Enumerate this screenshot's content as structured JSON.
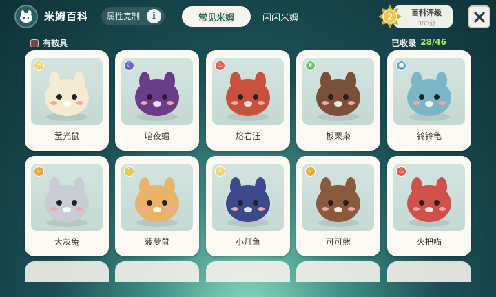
{
  "app": {
    "title": "米姆百科"
  },
  "attribute": {
    "label": "属性克制",
    "info_glyph": "i"
  },
  "tabs": [
    {
      "label": "常见米姆",
      "active": true
    },
    {
      "label": "闪闪米姆",
      "active": false
    }
  ],
  "rank": {
    "level": "2",
    "title": "百科评级",
    "score": "380分"
  },
  "filter": {
    "label": "有鞍具",
    "checked": true
  },
  "collection": {
    "label": "已收录",
    "count": "28/46"
  },
  "creatures": [
    {
      "name": "萤光鼠",
      "element": "light",
      "element_color": "#f2d46b"
    },
    {
      "name": "暗夜蝠",
      "element": "dark",
      "element_color": "#6b63c9"
    },
    {
      "name": "熔岩汪",
      "element": "fire",
      "element_color": "#ea5a4c"
    },
    {
      "name": "板栗枭",
      "element": "grass",
      "element_color": "#6cc16c"
    },
    {
      "name": "铃铃龟",
      "element": "water",
      "element_color": "#55a7e0"
    },
    {
      "name": "大灰兔",
      "element": "normal",
      "element_color": "#e9a15a"
    },
    {
      "name": "菠萝鼠",
      "element": "electric",
      "element_color": "#e8c93c"
    },
    {
      "name": "小灯鱼",
      "element": "light",
      "element_color": "#f2d46b"
    },
    {
      "name": "可可熊",
      "element": "normal",
      "element_color": "#e9a15a"
    },
    {
      "name": "火把喵",
      "element": "fire",
      "element_color": "#ea5a4c"
    }
  ]
}
